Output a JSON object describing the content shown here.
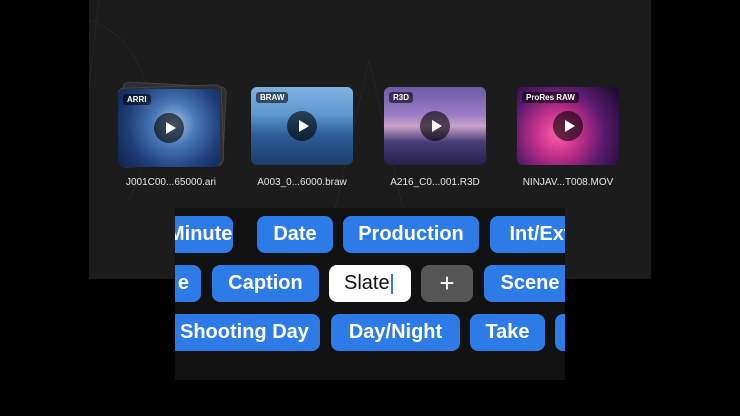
{
  "clips": [
    {
      "badge": "ARRI",
      "filename": "J001C00...65000.ari"
    },
    {
      "badge": "BRAW",
      "filename": "A003_0...6000.braw"
    },
    {
      "badge": "R3D",
      "filename": "A216_C0...001.R3D"
    },
    {
      "badge": "ProRes RAW",
      "filename": "NINJAV...T008.MOV"
    }
  ],
  "tags": {
    "row1": [
      "Minute",
      "Date",
      "Production",
      "Int/Ext"
    ],
    "row2": {
      "partial": "e",
      "caption": "Caption",
      "editing_value": "Slate",
      "add_icon": "+",
      "scene": "Scene"
    },
    "row3": [
      "Shooting Day",
      "Day/Night",
      "Take"
    ]
  },
  "colors": {
    "accent": "#2d7be6",
    "panel": "#1c1c1c",
    "background": "#000000"
  }
}
